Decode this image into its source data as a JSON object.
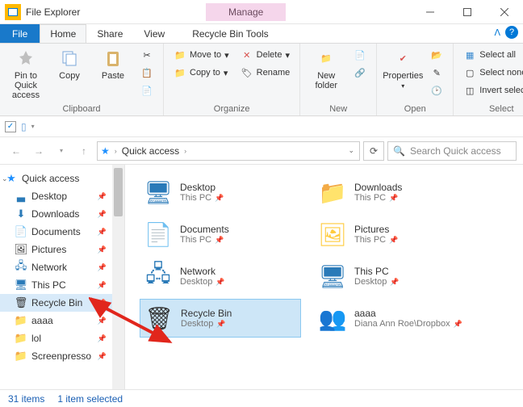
{
  "app": {
    "title": "File Explorer",
    "context_tab": "Manage"
  },
  "tabs": {
    "file": "File",
    "home": "Home",
    "share": "Share",
    "view": "View",
    "tools": "Recycle Bin Tools"
  },
  "ribbon": {
    "clipboard": {
      "label": "Clipboard",
      "pin": "Pin to Quick access",
      "copy": "Copy",
      "paste": "Paste"
    },
    "organize": {
      "label": "Organize",
      "moveto": "Move to",
      "copyto": "Copy to",
      "delete": "Delete",
      "rename": "Rename"
    },
    "new": {
      "label": "New",
      "folder": "New folder"
    },
    "open": {
      "label": "Open",
      "properties": "Properties"
    },
    "select": {
      "label": "Select",
      "all": "Select all",
      "none": "Select none",
      "invert": "Invert selection"
    }
  },
  "address": {
    "location": "Quick access"
  },
  "search": {
    "placeholder": "Search Quick access"
  },
  "tree": {
    "top": "Quick access",
    "items": [
      {
        "label": "Desktop",
        "pinned": true
      },
      {
        "label": "Downloads",
        "pinned": true
      },
      {
        "label": "Documents",
        "pinned": true
      },
      {
        "label": "Pictures",
        "pinned": true
      },
      {
        "label": "Network",
        "pinned": true
      },
      {
        "label": "This PC",
        "pinned": true
      },
      {
        "label": "Recycle Bin",
        "pinned": true
      },
      {
        "label": "aaaa",
        "pinned": true
      },
      {
        "label": "lol",
        "pinned": true
      },
      {
        "label": "Screenpresso",
        "pinned": true
      }
    ]
  },
  "items": [
    {
      "name": "Desktop",
      "sub": "This PC",
      "pinned": true
    },
    {
      "name": "Downloads",
      "sub": "This PC",
      "pinned": true
    },
    {
      "name": "Documents",
      "sub": "This PC",
      "pinned": true
    },
    {
      "name": "Pictures",
      "sub": "This PC",
      "pinned": true
    },
    {
      "name": "Network",
      "sub": "Desktop",
      "pinned": true
    },
    {
      "name": "This PC",
      "sub": "Desktop",
      "pinned": true
    },
    {
      "name": "Recycle Bin",
      "sub": "Desktop",
      "pinned": true,
      "selected": true
    },
    {
      "name": "aaaa",
      "sub": "Diana Ann Roe\\Dropbox",
      "pinned": true
    }
  ],
  "status": {
    "count": "31 items",
    "selection": "1 item selected"
  }
}
